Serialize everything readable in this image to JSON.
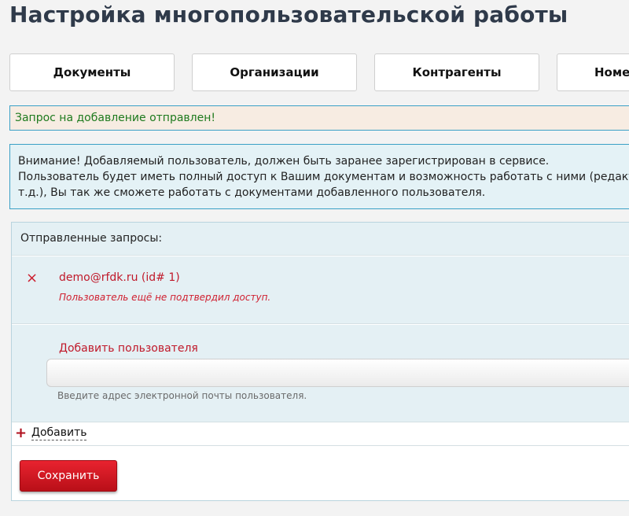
{
  "page": {
    "title": "Настройка многопользовательской работы"
  },
  "tabs": [
    "Документы",
    "Организации",
    "Контрагенты",
    "Номе"
  ],
  "alerts": {
    "success": "Запрос на добавление отправлен!",
    "info_lines": [
      "Внимание! Добавляемый пользователь, должен быть заранее зарегистрирован в сервисе.",
      "Пользователь будет иметь полный доступ к Вашим документам и возможность работать с ними (редакт",
      "т.д.), Вы так же сможете работать с документами добавленного пользователя."
    ]
  },
  "requests": {
    "header": "Отправленные запросы:",
    "items": [
      {
        "email": "demo@rfdk.ru (id# 1)",
        "status": "Пользователь ещё не подтвердил доступ.",
        "remove_icon": "×"
      }
    ]
  },
  "add_user": {
    "label": "Добавить пользователя",
    "input_value": "",
    "hint": "Введите адрес электронной почты пользователя.",
    "add_link": "Добавить",
    "add_icon": "+"
  },
  "actions": {
    "save": "Сохранить"
  },
  "colors": {
    "accent_red": "#c0192a",
    "success_green": "#1e7a1e",
    "info_border": "#3aa0c6"
  }
}
